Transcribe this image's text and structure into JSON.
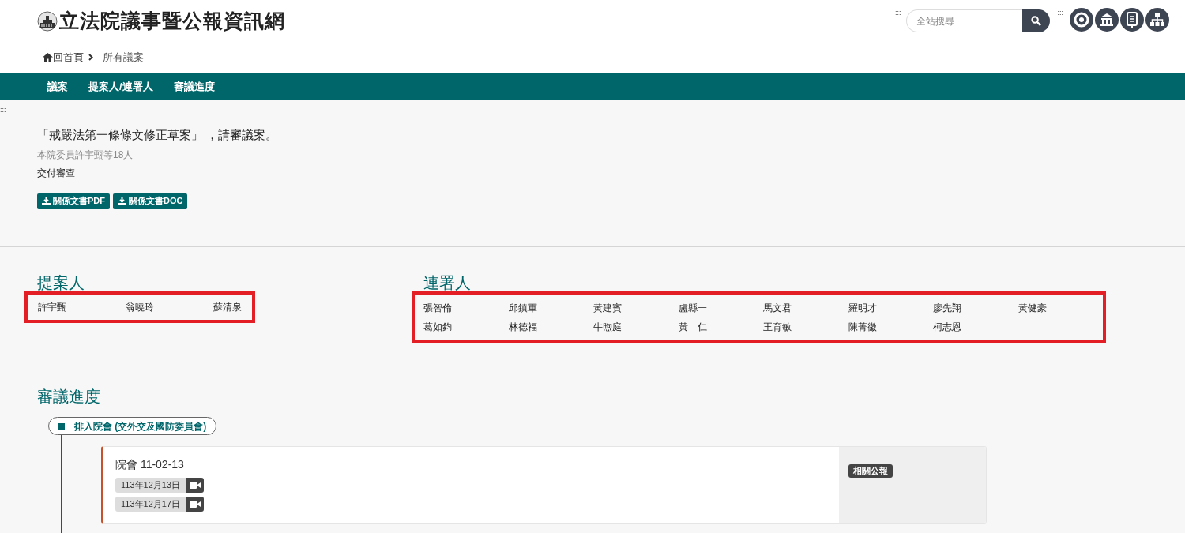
{
  "header": {
    "site_title": "立法院議事暨公報資訊網",
    "accesskey_search": ":::",
    "search": {
      "placeholder": "全站搜尋"
    },
    "accesskey_icons": ":::"
  },
  "breadcrumb": {
    "home": "回首頁",
    "current": "所有議案"
  },
  "nav": {
    "items": [
      "議案",
      "提案人/連署人",
      "審議進度"
    ]
  },
  "accesskey_main": ":::",
  "bill": {
    "title": "「戒嚴法第一條條文修正草案」 ，請審議案。",
    "proposer_line": "本院委員許宇甄等18人",
    "status": "交付審查",
    "downloads": [
      "關係文書PDF",
      "關係文書DOC"
    ]
  },
  "proposers": {
    "heading": "提案人",
    "names": [
      "許宇甄",
      "翁曉玲",
      "蘇清泉"
    ]
  },
  "cosigners": {
    "heading": "連署人",
    "names": [
      "張智倫",
      "邱鎮軍",
      "黃建賓",
      "盧縣一",
      "馬文君",
      "羅明才",
      "廖先翔",
      "黃健豪",
      "葛如鈞",
      "林德福",
      "牛煦庭",
      "黃　仁",
      "王育敏",
      "陳菁徽",
      "柯志恩"
    ]
  },
  "progress": {
    "heading": "審議進度",
    "stage": "排入院會 (交外交及國防委員會)",
    "meeting": {
      "title": "院會 11-02-13",
      "dates": [
        "113年12月13日",
        "113年12月17日"
      ],
      "badge": "相關公報"
    }
  }
}
